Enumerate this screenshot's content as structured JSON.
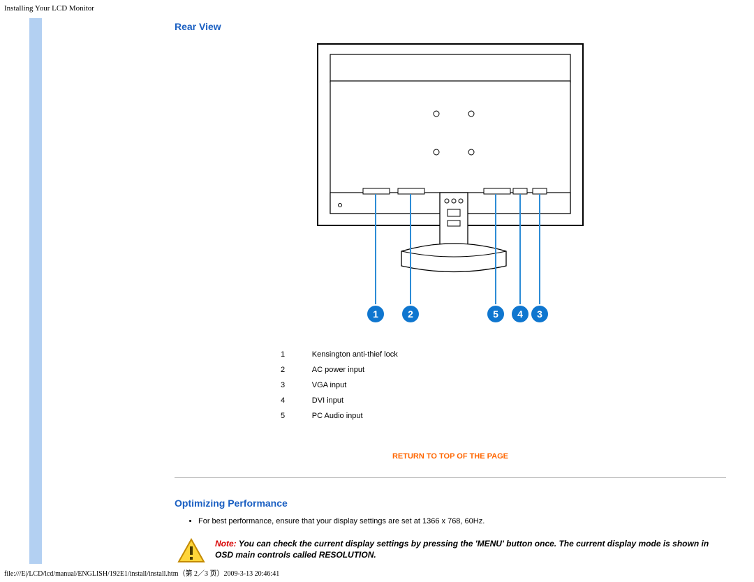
{
  "header_text": "Installing Your LCD Monitor",
  "rear_view_heading": "Rear View",
  "legend": [
    {
      "num": "1",
      "label": "Kensington anti-thief lock"
    },
    {
      "num": "2",
      "label": "AC power input"
    },
    {
      "num": "3",
      "label": "VGA input"
    },
    {
      "num": "4",
      "label": "DVI input"
    },
    {
      "num": "5",
      "label": "PC Audio  input"
    }
  ],
  "return_link": "RETURN TO TOP OF THE PAGE",
  "opt_heading": "Optimizing Performance",
  "opt_bullet": "For best performance, ensure that your display settings are set at 1366 x 768, 60Hz.",
  "note_label": "Note: ",
  "note_body": "You can check the current display settings by pressing the 'MENU' button once. The current display mode is shown in OSD main controls called RESOLUTION.",
  "footer_text": "file:///E|/LCD/lcd/manual/ENGLISH/192E1/install/install.htm（第 2／3 页）2009-3-13 20:46:41",
  "callouts": [
    "1",
    "2",
    "3",
    "4",
    "5"
  ]
}
